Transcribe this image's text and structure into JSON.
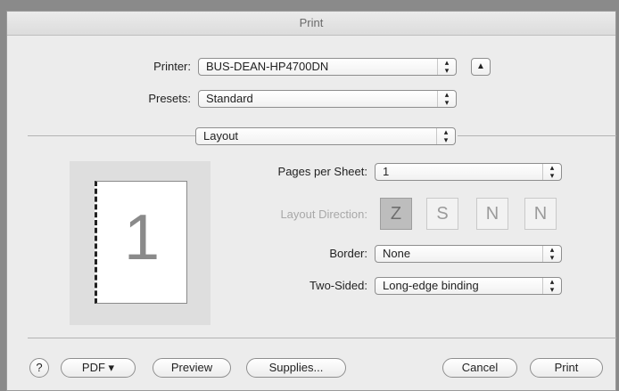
{
  "window": {
    "title": "Print"
  },
  "printer": {
    "label": "Printer:",
    "value": "BUS-DEAN-HP4700DN",
    "disclosure_icon": "triangle-up-icon"
  },
  "presets": {
    "label": "Presets:",
    "value": "Standard"
  },
  "section": {
    "value": "Layout"
  },
  "preview": {
    "page_number": "1"
  },
  "layout": {
    "pages_per_sheet": {
      "label": "Pages per Sheet:",
      "value": "1"
    },
    "direction": {
      "label": "Layout Direction:",
      "options": [
        {
          "icon": "z-icon",
          "glyph": "Z"
        },
        {
          "icon": "s-reverse-icon",
          "glyph": "S"
        },
        {
          "icon": "n-icon",
          "glyph": "N"
        },
        {
          "icon": "n-reverse-icon",
          "glyph": "N"
        }
      ],
      "selected": 0
    },
    "border": {
      "label": "Border:",
      "value": "None"
    },
    "two_sided": {
      "label": "Two-Sided:",
      "value": "Long-edge binding"
    }
  },
  "buttons": {
    "help": "?",
    "pdf": "PDF ▾",
    "preview": "Preview",
    "supplies": "Supplies...",
    "cancel": "Cancel",
    "print": "Print"
  }
}
